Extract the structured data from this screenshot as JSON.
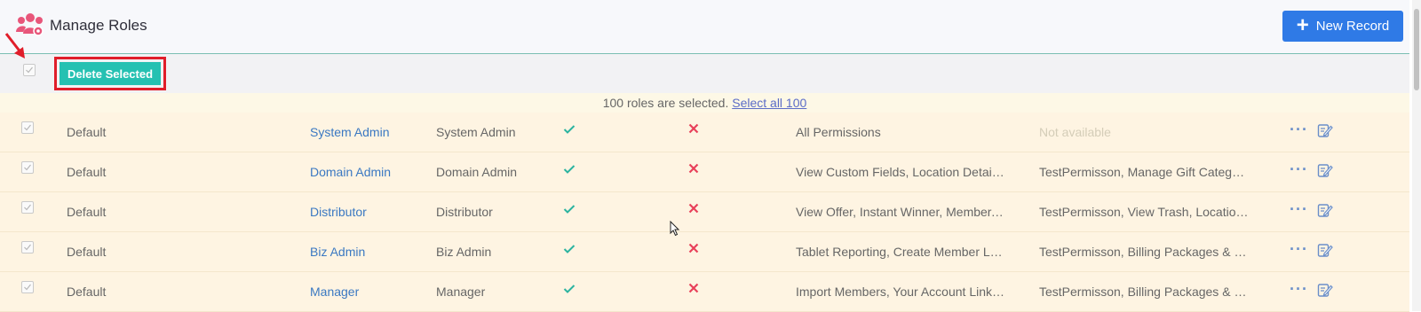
{
  "header": {
    "title": "Manage Roles",
    "title_icon": "users-gear-icon",
    "new_record_label": "New Record",
    "accent_color": "#2f7ae6"
  },
  "toolbar": {
    "delete_selected_label": "Delete Selected",
    "delete_color": "#25c1b2",
    "highlight_color": "#e01e2a"
  },
  "selection": {
    "message": "100 roles are selected.",
    "select_all_label": "Select all 100"
  },
  "rows": [
    {
      "type": "Default",
      "name": "System Admin",
      "display": "System Admin",
      "permissions": "All Permissions",
      "other": "Not available",
      "other_available": false
    },
    {
      "type": "Default",
      "name": "Domain Admin",
      "display": "Domain Admin",
      "permissions": "View Custom Fields, Location Details, Manage Members",
      "other": "TestPermisson, Manage Gift Categories",
      "other_available": true
    },
    {
      "type": "Default",
      "name": "Distributor",
      "display": "Distributor",
      "permissions": "View Offer, Instant Winner, Member, Reports",
      "other": "TestPermisson, View Trash, Location Details",
      "other_available": true
    },
    {
      "type": "Default",
      "name": "Biz Admin",
      "display": "Biz Admin",
      "permissions": "Tablet Reporting, Create Member List, Reports",
      "other": "TestPermisson, Billing Packages & Billing",
      "other_available": true
    },
    {
      "type": "Default",
      "name": "Manager",
      "display": "Manager",
      "permissions": "Import Members, Your Account Link, Reports",
      "other": "TestPermisson, Billing Packages & Billing",
      "other_available": true
    }
  ]
}
